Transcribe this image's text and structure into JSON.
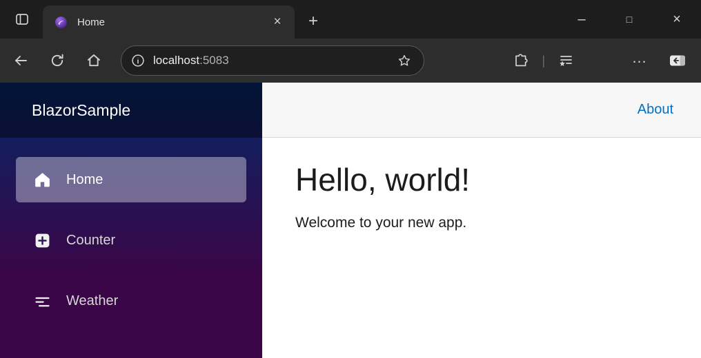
{
  "browser": {
    "tab_title": "Home",
    "url_host": "localhost",
    "url_port": ":5083",
    "glyphs": {
      "close": "×",
      "new_tab": "+",
      "minimize": "–",
      "maximize": "□",
      "more": "…",
      "divider": "|"
    }
  },
  "app": {
    "brand": "BlazorSample",
    "nav": [
      {
        "label": "Home",
        "active": true
      },
      {
        "label": "Counter",
        "active": false
      },
      {
        "label": "Weather",
        "active": false
      }
    ],
    "about_label": "About",
    "heading": "Hello, world!",
    "welcome_text": "Welcome to your new app."
  },
  "colors": {
    "link_blue": "#0071c1",
    "sidebar_gradient_top": "#052767",
    "sidebar_gradient_bottom": "#3a0647",
    "blazor_purple": "#5c2d91",
    "content_topbar_bg": "#f7f7f7"
  }
}
